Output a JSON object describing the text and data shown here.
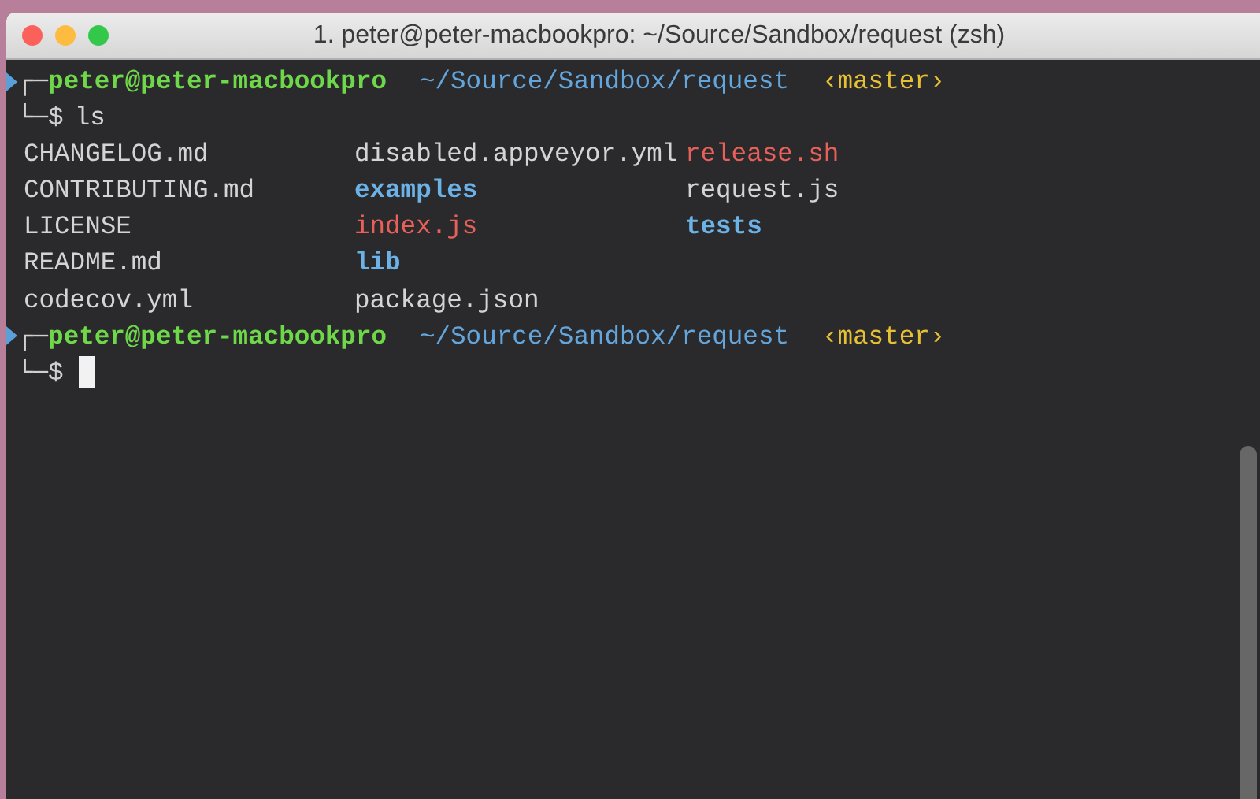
{
  "window": {
    "title": "1. peter@peter-macbookpro: ~/Source/Sandbox/request (zsh)"
  },
  "sessions": [
    {
      "prompt": {
        "top_prefix": "┌─",
        "user_host": "peter@peter-macbookpro",
        "path": "~/Source/Sandbox/request",
        "branch": "‹master›",
        "bottom_prefix": "└─$"
      },
      "command": "ls",
      "listing": {
        "columns": [
          [
            {
              "name": "CHANGELOG.md",
              "kind": "file"
            },
            {
              "name": "CONTRIBUTING.md",
              "kind": "file"
            },
            {
              "name": "LICENSE",
              "kind": "file"
            },
            {
              "name": "README.md",
              "kind": "file"
            },
            {
              "name": "codecov.yml",
              "kind": "file"
            }
          ],
          [
            {
              "name": "disabled.appveyor.yml",
              "kind": "file"
            },
            {
              "name": "examples",
              "kind": "dir"
            },
            {
              "name": "index.js",
              "kind": "exec"
            },
            {
              "name": "lib",
              "kind": "dir"
            },
            {
              "name": "package.json",
              "kind": "file"
            }
          ],
          [
            {
              "name": "release.sh",
              "kind": "exec"
            },
            {
              "name": "request.js",
              "kind": "file"
            },
            {
              "name": "tests",
              "kind": "dir"
            }
          ]
        ]
      }
    },
    {
      "prompt": {
        "top_prefix": "┌─",
        "user_host": "peter@peter-macbookpro",
        "path": "~/Source/Sandbox/request",
        "branch": "‹master›",
        "bottom_prefix": "└─$"
      },
      "cursor": true
    }
  ]
}
